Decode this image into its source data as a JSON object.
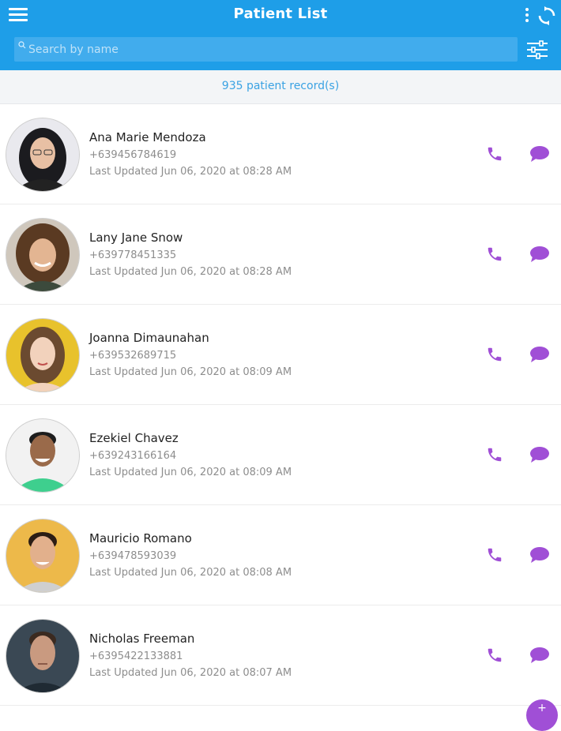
{
  "header": {
    "title": "Patient List",
    "menu_icon": "hamburger-menu-icon",
    "more_icon": "more-vertical-icon",
    "sync_icon": "sync-icon",
    "filter_icon": "filter-sliders-icon",
    "color": "#1e9ee8"
  },
  "search": {
    "placeholder": "Search by name",
    "value": ""
  },
  "record_count": "935 patient record(s)",
  "accent_color": "#a04fd6",
  "patients": [
    {
      "name": "Ana Marie Mendoza",
      "phone": "+639456784619",
      "updated": "Last Updated Jun 06, 2020 at 08:28 AM"
    },
    {
      "name": "Lany Jane Snow",
      "phone": "+639778451335",
      "updated": "Last Updated Jun 06, 2020 at 08:28 AM"
    },
    {
      "name": "Joanna Dimaunahan",
      "phone": "+639532689715",
      "updated": "Last Updated Jun 06, 2020 at 08:09 AM"
    },
    {
      "name": "Ezekiel Chavez",
      "phone": "+639243166164",
      "updated": "Last Updated Jun 06, 2020 at 08:09 AM"
    },
    {
      "name": "Mauricio Romano",
      "phone": "+639478593039",
      "updated": "Last Updated Jun 06, 2020 at 08:08 AM"
    },
    {
      "name": "Nicholas Freeman",
      "phone": "+6395422133881",
      "updated": "Last Updated Jun 06, 2020 at 08:07 AM"
    }
  ],
  "fab": {
    "icon": "add-icon"
  }
}
